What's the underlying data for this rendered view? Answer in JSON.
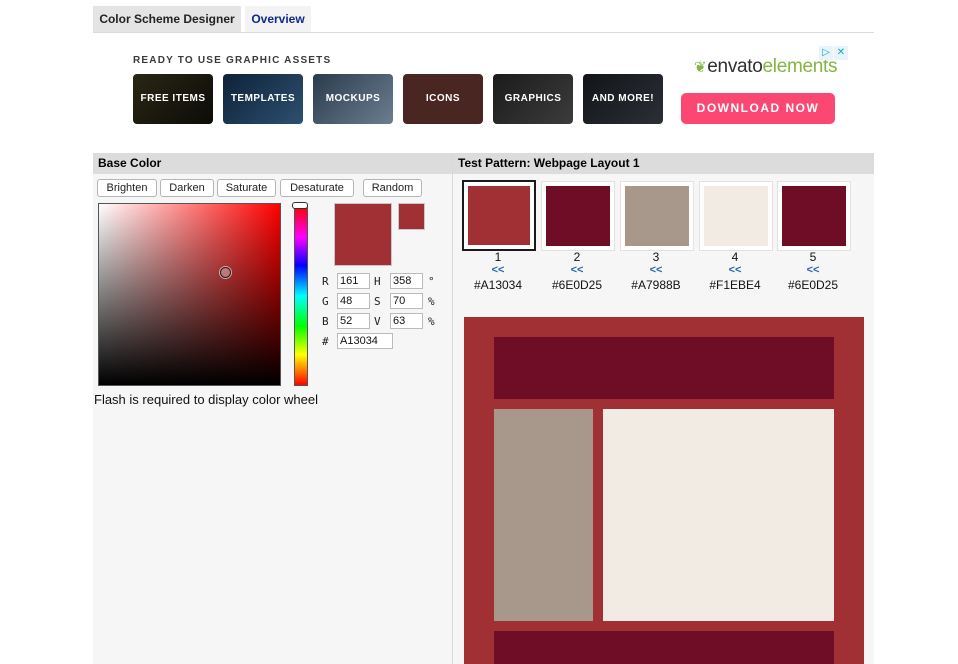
{
  "tabs": {
    "active": "Color Scheme Designer",
    "inactive": "Overview"
  },
  "ad": {
    "heading": "READY TO USE GRAPHIC ASSETS",
    "tiles": [
      "FREE ITEMS",
      "TEMPLATES",
      "MOCKUPS",
      "ICONS",
      "GRAPHICS",
      "AND MORE!"
    ],
    "logo_envato": "envato",
    "logo_elements": "elements",
    "download_label": "DOWNLOAD NOW",
    "adchoices_glyph": "▷",
    "close_glyph": "✕"
  },
  "base_color": {
    "title": "Base Color",
    "buttons": [
      "Brighten",
      "Darken",
      "Saturate",
      "Desaturate",
      "Random"
    ],
    "labels": {
      "r": "R",
      "g": "G",
      "b": "B",
      "h": "H",
      "s": "S",
      "v": "V",
      "hash": "#",
      "deg": "°",
      "pct": "%"
    },
    "r": "161",
    "g": "48",
    "b": "52",
    "h": "358",
    "s": "70",
    "v": "63",
    "hex": "A13034",
    "preview_color": "#A13034",
    "flash_note": "Flash is required to display color wheel"
  },
  "test_pattern": {
    "title": "Test Pattern: Webpage Layout 1",
    "arrow": "<<",
    "swatches": [
      {
        "num": "1",
        "hex": "#A13034",
        "color": "#A13034"
      },
      {
        "num": "2",
        "hex": "#6E0D25",
        "color": "#6E0D25"
      },
      {
        "num": "3",
        "hex": "#A7988B",
        "color": "#A7988B"
      },
      {
        "num": "4",
        "hex": "#F1EBE4",
        "color": "#F1EBE4"
      },
      {
        "num": "5",
        "hex": "#6E0D25",
        "color": "#6E0D25"
      }
    ]
  }
}
